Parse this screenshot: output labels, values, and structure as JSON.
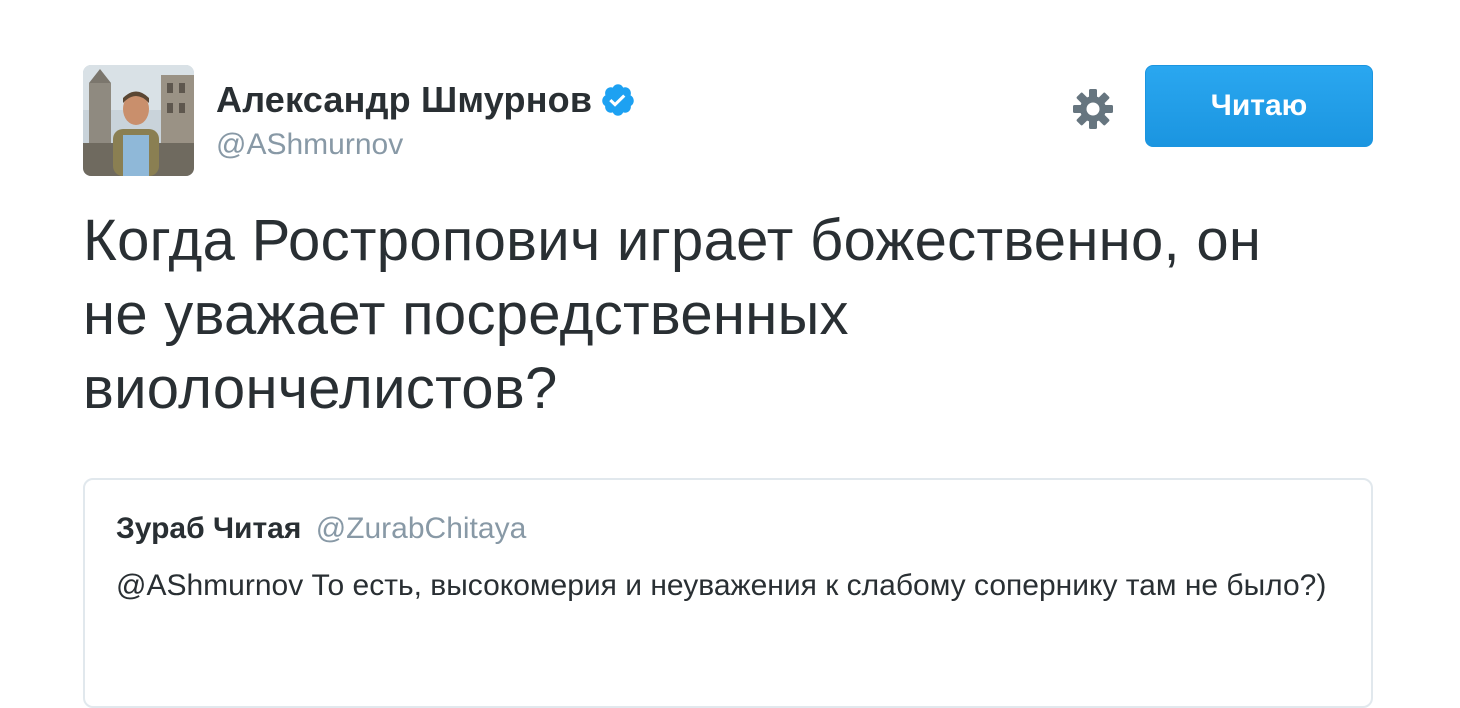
{
  "tweet": {
    "author": {
      "fullname": "Александр Шмурнов",
      "username": "@AShmurnov",
      "verified": true,
      "avatar": "profile-photo"
    },
    "follow_button_label": "Читаю",
    "settings_icon": "gear-icon",
    "text": "Когда Ростропович играет божественно, он\nне уважает посредственных\nвиолончелистов?",
    "quoted": {
      "fullname": "Зураб Читая",
      "username": "@ZurabChitaya",
      "text": "@AShmurnov То есть, высокомерия и неуважения к слабому сопернику там не было?)"
    }
  },
  "colors": {
    "accent": "#1da1f2",
    "text": "#292f33",
    "secondary_text": "#8899a6",
    "border": "#e1e8ed",
    "verified": "#1da1f2"
  }
}
